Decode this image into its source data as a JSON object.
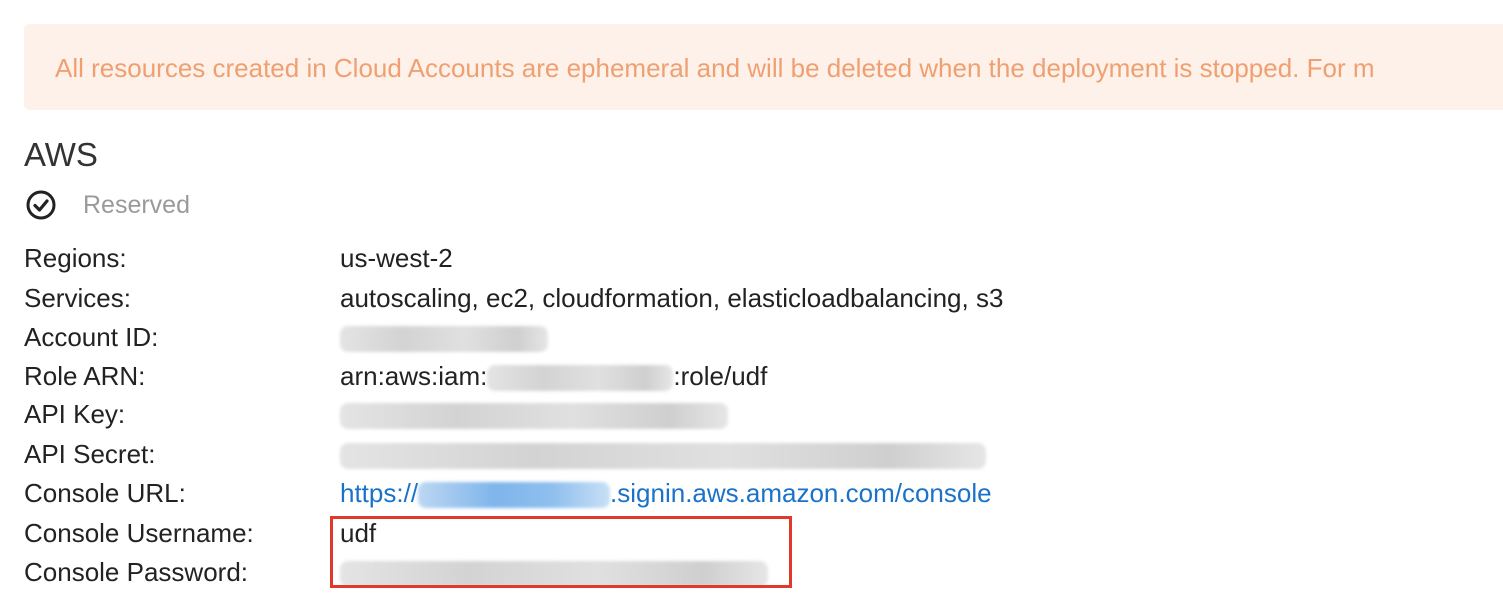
{
  "banner": {
    "text": "All resources created in Cloud Accounts are ephemeral and will be deleted when the deployment is stopped. For m"
  },
  "account": {
    "title": "AWS",
    "status_label": "Reserved",
    "status_icon": "check-circle-icon"
  },
  "details": {
    "regions": {
      "label": "Regions:",
      "value": "us-west-2"
    },
    "services": {
      "label": "Services:",
      "value": "autoscaling, ec2, cloudformation, elasticloadbalancing, s3"
    },
    "account_id": {
      "label": "Account ID:"
    },
    "role_arn": {
      "label": "Role ARN:",
      "prefix": "arn:aws:iam:",
      "suffix": ":role/udf"
    },
    "api_key": {
      "label": "API Key:"
    },
    "api_secret": {
      "label": "API Secret:"
    },
    "console_url": {
      "label": "Console URL:",
      "prefix": "https://",
      "suffix": ".signin.aws.amazon.com/console"
    },
    "console_username": {
      "label": "Console Username:",
      "value": "udf"
    },
    "console_password": {
      "label": "Console Password:"
    }
  },
  "colors": {
    "banner_bg": "#fdf1ea",
    "banner_text": "#f0a070",
    "link": "#1a72c9",
    "highlight": "#e03a2f"
  }
}
